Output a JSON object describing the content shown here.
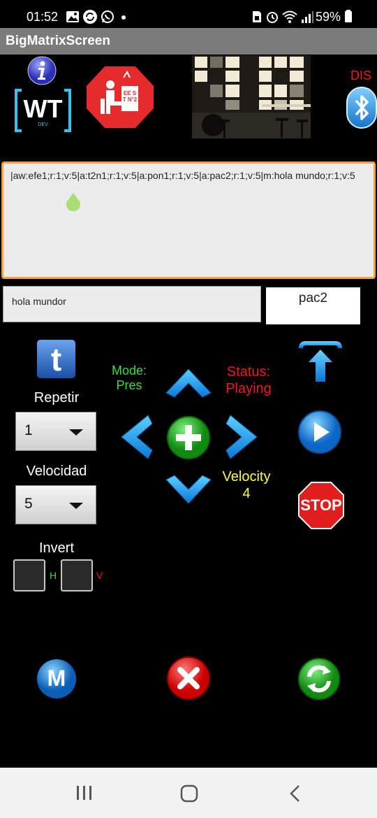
{
  "status_bar": {
    "time": "01:52",
    "battery": "59%",
    "left_icons": [
      "image-icon",
      "sync-icon",
      "whatsapp-icon",
      "dot-icon"
    ],
    "right_icons": [
      "sim-icon",
      "alarm-icon",
      "wifi-icon",
      "signal-icon",
      "battery-icon"
    ]
  },
  "app": {
    "title": "BigMatrixScreen"
  },
  "header": {
    "bt_status": "DIS",
    "logo_wt": "WT",
    "logo_wt_sub": "DEV",
    "school_badge_text": "EE ST N°2",
    "school_badge_sub": "JUNÍN"
  },
  "command": {
    "text": "|aw:efe1;r:1;v:5|a:t2n1;r:1;v:5|a:pon1;r:1;v:5|a:pac2;r:1;v:5|m:hola mundo;r:1;v:5"
  },
  "message_input": {
    "value": "hola mundor"
  },
  "current_animation": "pac2",
  "controls": {
    "repeat_label": "Repetir",
    "repeat_value": "1",
    "speed_label": "Velocidad",
    "speed_value": "5",
    "invert_label": "Invert",
    "invert_h": "H",
    "invert_v": "V",
    "mode_label": "Mode:",
    "mode_value": "Pres",
    "status_label": "Status:",
    "status_value": "Playing",
    "velocity_label": "Velocity",
    "velocity_value": "4",
    "stop_label": "STOP",
    "t_label": "t",
    "m_label": "M"
  },
  "colors": {
    "title_bar": "#7a7a7a",
    "accent_orange": "#f6a13a",
    "blue_button": "#1a8fe0",
    "green_button": "#22b322",
    "red_button": "#e02020"
  }
}
